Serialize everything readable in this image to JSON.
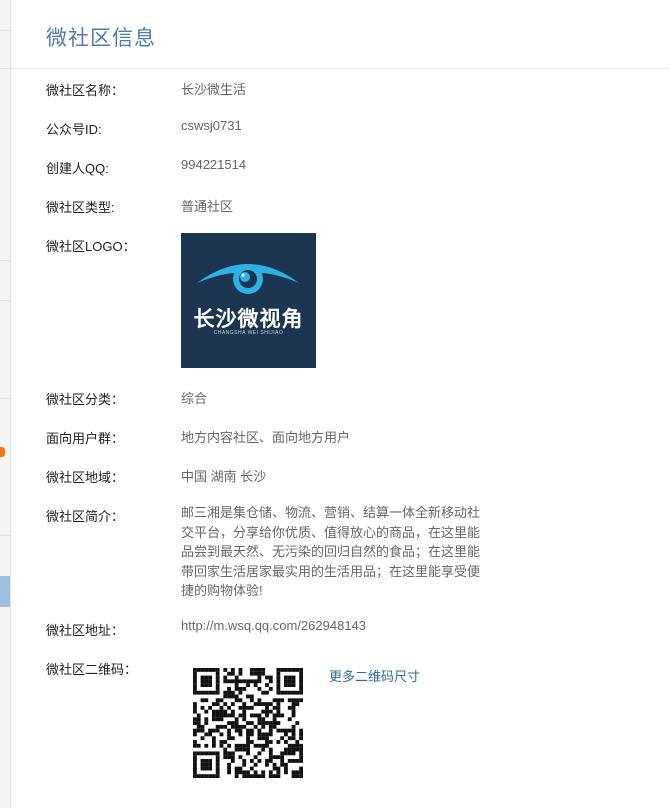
{
  "title": "微社区信息",
  "fields": {
    "name": {
      "label": "微社区名称：",
      "value": "长沙微生活"
    },
    "public_id": {
      "label": "公众号ID:",
      "value": "cswsj0731"
    },
    "creator_qq": {
      "label": "创建人QQ:",
      "value": "994221514"
    },
    "type": {
      "label": "微社区类型:",
      "value": "普通社区"
    },
    "logo": {
      "label": "微社区LOGO：",
      "text": "长沙微视角",
      "subtext": "CHANGSHA WEI SHIJIAO",
      "icon": "eye-logo-icon"
    },
    "category": {
      "label": "微社区分类：",
      "value": "综合"
    },
    "audience": {
      "label": "面向用户群：",
      "value": "地方内容社区、面向地方用户"
    },
    "region": {
      "label": "微社区地域：",
      "value": "中国 湖南 长沙"
    },
    "intro": {
      "label": "微社区简介：",
      "value": "邮三湘是集仓储、物流、营销、结算一体全新移动社交平台，分享给你优质、值得放心的商品，在这里能品尝到最天然、无污染的回归自然的食品；在这里能带回家生活居家最实用的生活用品；在这里能享受便捷的购物体验!"
    },
    "address": {
      "label": "微社区地址：",
      "value": "http://m.wsq.qq.com/262948143"
    },
    "qrcode": {
      "label": "微社区二维码：",
      "link": "更多二维码尺寸",
      "icon": "qr-code-icon"
    }
  },
  "colors": {
    "title": "#4f7cb0",
    "label": "#222222",
    "value": "#666666",
    "link": "#2f6aa0",
    "logo_bg": "#1c3550",
    "logo_accent": "#2bb3e6"
  }
}
